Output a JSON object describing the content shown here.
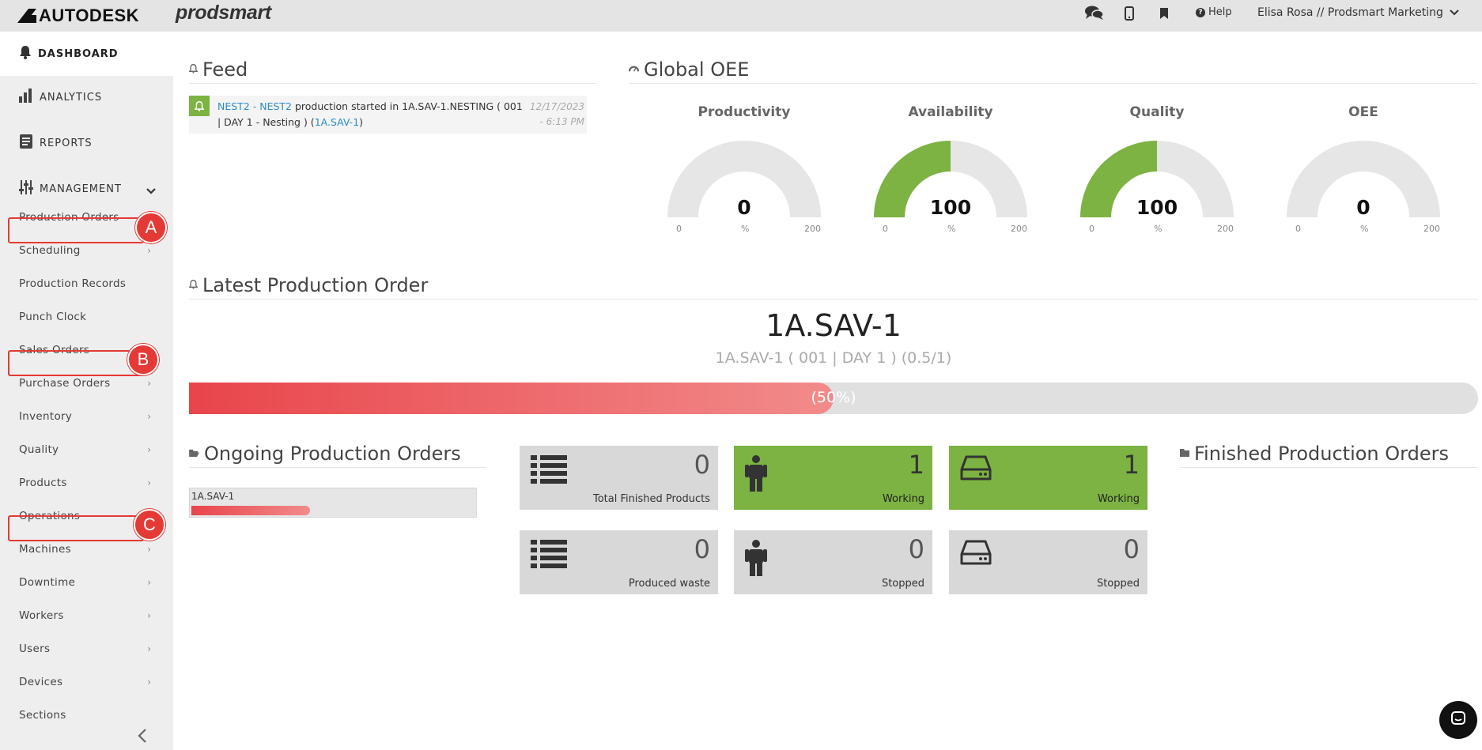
{
  "header": {
    "brand": "AUTODESK",
    "product": "prodsmart",
    "help_label": "Help",
    "user_label": "Elisa Rosa // Prodsmart Marketing"
  },
  "sidebar": {
    "dashboard": "DASHBOARD",
    "analytics": "ANALYTICS",
    "reports": "REPORTS",
    "management": "MANAGEMENT",
    "items": [
      {
        "label": "Production Orders",
        "has_arrow": false
      },
      {
        "label": "Scheduling",
        "has_arrow": true
      },
      {
        "label": "Production Records",
        "has_arrow": false
      },
      {
        "label": "Punch Clock",
        "has_arrow": false
      },
      {
        "label": "Sales Orders",
        "has_arrow": false
      },
      {
        "label": "Purchase Orders",
        "has_arrow": true
      },
      {
        "label": "Inventory",
        "has_arrow": true
      },
      {
        "label": "Quality",
        "has_arrow": true
      },
      {
        "label": "Products",
        "has_arrow": true
      },
      {
        "label": "Operations",
        "has_arrow": false
      },
      {
        "label": "Machines",
        "has_arrow": true
      },
      {
        "label": "Downtime",
        "has_arrow": true
      },
      {
        "label": "Workers",
        "has_arrow": true
      },
      {
        "label": "Users",
        "has_arrow": true
      },
      {
        "label": "Devices",
        "has_arrow": true
      },
      {
        "label": "Sections",
        "has_arrow": false
      }
    ],
    "arrow": "›"
  },
  "annotations": [
    "A",
    "B",
    "C"
  ],
  "feed": {
    "title": "Feed",
    "item": {
      "link1": "NEST2 - NEST2",
      "text1": " production started in 1A.SAV-1.NESTING ( 001 | DAY 1 - Nesting ) (",
      "link2": "1A.SAV-1",
      "text2": ")",
      "date": "12/17/2023",
      "time": "- 6:13 PM"
    }
  },
  "oee": {
    "title": "Global OEE",
    "gauges": [
      {
        "label": "Productivity",
        "value": "0",
        "fraction": 0,
        "min": "0",
        "max": "200",
        "unit": "%"
      },
      {
        "label": "Availability",
        "value": "100",
        "fraction": 0.5,
        "min": "0",
        "max": "200",
        "unit": "%"
      },
      {
        "label": "Quality",
        "value": "100",
        "fraction": 0.5,
        "min": "0",
        "max": "200",
        "unit": "%"
      },
      {
        "label": "OEE",
        "value": "0",
        "fraction": 0,
        "min": "0",
        "max": "200",
        "unit": "%"
      }
    ],
    "fill_color": "#7cb342",
    "track_color": "#e6e6e6"
  },
  "latest": {
    "title": "Latest Production Order",
    "order": "1A.SAV-1",
    "subtitle": "1A.SAV-1 ( 001 | DAY 1 ) (0.5/1)",
    "percent_label": "(50%)",
    "progress": 0.5
  },
  "ongoing": {
    "title": "Ongoing Production Orders",
    "orders": [
      {
        "label": "1A.SAV-1",
        "progress": 0.42
      }
    ]
  },
  "tiles": [
    {
      "value": "0",
      "caption": "Total Finished Products",
      "icon": "list-icon",
      "green": false
    },
    {
      "value": "1",
      "caption": "Working",
      "icon": "worker-icon",
      "green": true
    },
    {
      "value": "1",
      "caption": "Working",
      "icon": "machine-icon",
      "green": true
    },
    {
      "value": "0",
      "caption": "Produced waste",
      "icon": "list-icon",
      "green": false
    },
    {
      "value": "0",
      "caption": "Stopped",
      "icon": "worker-icon",
      "green": false
    },
    {
      "value": "0",
      "caption": "Stopped",
      "icon": "machine-icon",
      "green": false
    }
  ],
  "finished": {
    "title": "Finished Production Orders"
  }
}
